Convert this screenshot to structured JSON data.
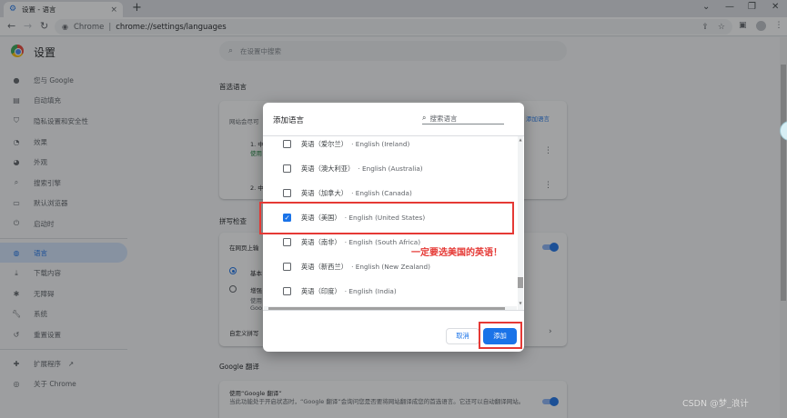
{
  "browser": {
    "tab_title": "设置 - 语言",
    "tab_close": "×",
    "new_tab": "+",
    "window_controls": [
      "⌄",
      "—",
      "❐",
      "✕"
    ],
    "scheme": "Chrome",
    "separator": "|",
    "url": "chrome://settings/languages"
  },
  "settings": {
    "title": "设置",
    "search_placeholder": "在设置中搜索",
    "sidebar": [
      {
        "label": "您与 Google",
        "icon": "person-icon"
      },
      {
        "label": "自动填充",
        "icon": "autofill-icon"
      },
      {
        "label": "隐私设置和安全性",
        "icon": "shield-icon"
      },
      {
        "label": "效果",
        "icon": "performance-icon"
      },
      {
        "label": "外观",
        "icon": "palette-icon"
      },
      {
        "label": "搜索引擎",
        "icon": "search-icon"
      },
      {
        "label": "默认浏览器",
        "icon": "browser-icon"
      },
      {
        "label": "启动时",
        "icon": "power-icon"
      },
      {
        "label": "语言",
        "icon": "globe-icon",
        "active": true
      },
      {
        "label": "下载内容",
        "icon": "download-icon"
      },
      {
        "label": "无障碍",
        "icon": "accessibility-icon"
      },
      {
        "label": "系统",
        "icon": "wrench-icon"
      },
      {
        "label": "重置设置",
        "icon": "reset-icon"
      },
      {
        "label": "扩展程序",
        "icon": "puzzle-icon"
      },
      {
        "label": "关于 Chrome",
        "icon": "chrome-icon"
      }
    ],
    "sections": {
      "preferred_languages": "首选语言",
      "pref_card_text": "网站会尽可",
      "add_languages_btn": "添加语言",
      "lang_item_1": "1. 中",
      "lang_item_1_sub": "使用",
      "lang_item_2": "2. 中",
      "spellcheck": "拼写检查",
      "spell_row": "在网页上输",
      "radio_basic": "基本",
      "radio_enhanced": "增强",
      "radio_enhanced_sub1": "使用",
      "radio_enhanced_sub2": "Goo",
      "custom_spell": "自定义拼写",
      "google_translate": "Google 翻译",
      "translate_title": "使用“Google 翻译”",
      "translate_desc": "当此功能处于开启状态时，“Google 翻译”会询问您是否要将网站翻译成您的首选语言。它还可以自动翻译网站。"
    }
  },
  "dialog": {
    "title": "添加语言",
    "search_placeholder": "搜索语言",
    "languages": [
      {
        "native": "英语（爱尔兰）",
        "english": "· English (Ireland)",
        "checked": false
      },
      {
        "native": "英语（澳大利亚）",
        "english": "· English (Australia)",
        "checked": false
      },
      {
        "native": "英语（加拿大）",
        "english": "· English (Canada)",
        "checked": false
      },
      {
        "native": "英语（美国）",
        "english": "· English (United States)",
        "checked": true
      },
      {
        "native": "英语（南非）",
        "english": "· English (South Africa)",
        "checked": false
      },
      {
        "native": "英语（新西兰）",
        "english": "· English (New Zealand)",
        "checked": false
      },
      {
        "native": "英语（印度）",
        "english": "· English (India)",
        "checked": false
      }
    ],
    "cancel": "取消",
    "add": "添加"
  },
  "annotation": {
    "note": "一定要选美国的英语！",
    "color": "#e53935"
  },
  "watermark": "CSDN @梦_浪计"
}
